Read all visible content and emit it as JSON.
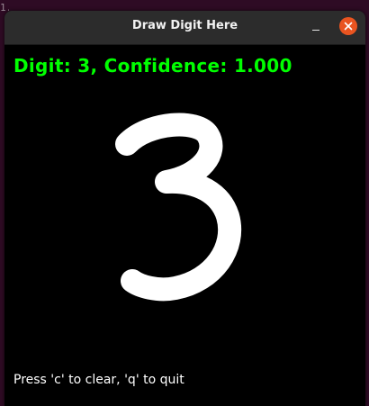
{
  "window": {
    "title": "Draw Digit Here",
    "minimize_symbol": "–",
    "close_icon": "close-icon",
    "accent_close": "#e95420"
  },
  "canvas": {
    "result_text": "Digit: 3, Confidence: 1.000",
    "result_color": "#00ff00",
    "hint_text": "Press 'c' to clear, 'q' to quit",
    "hint_color": "#ffffff",
    "background_color": "#000000",
    "stroke_color": "#ffffff"
  },
  "background_terminal": {
    "fragment": "1.000)"
  }
}
